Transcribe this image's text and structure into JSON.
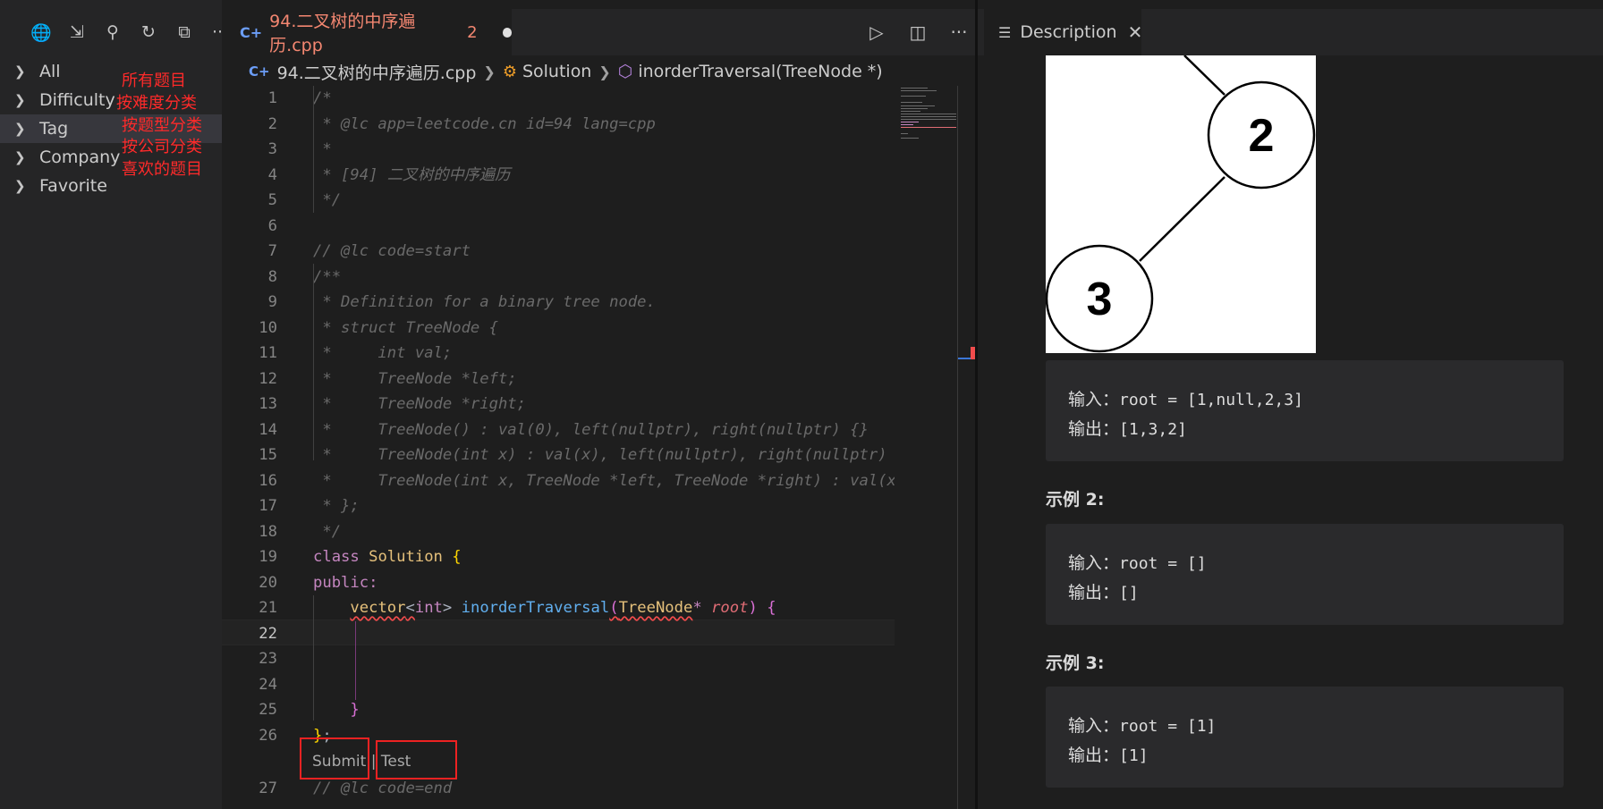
{
  "sidebar": {
    "toolbar": [
      {
        "icon": "globe-icon",
        "glyph": "🌐"
      },
      {
        "icon": "sign-in-icon",
        "glyph": "⇲"
      },
      {
        "icon": "search-icon",
        "glyph": "⚲"
      },
      {
        "icon": "refresh-icon",
        "glyph": "↻"
      },
      {
        "icon": "collapse-all-icon",
        "glyph": "⧉"
      },
      {
        "icon": "more-icon",
        "glyph": "···"
      }
    ],
    "items": [
      {
        "label": "All",
        "annotation": "所有题目"
      },
      {
        "label": "Difficulty",
        "annotation": "按难度分类"
      },
      {
        "label": "Tag",
        "annotation": "按题型分类"
      },
      {
        "label": "Company",
        "annotation": "按公司分类"
      },
      {
        "label": "Favorite",
        "annotation": "喜欢的题目"
      }
    ]
  },
  "editor": {
    "tab": {
      "title": "94.二叉树的中序遍历.cpp",
      "problem_count": "2",
      "icon": "cpp-file-icon"
    },
    "actions": [
      {
        "icon": "run-icon",
        "glyph": "▷"
      },
      {
        "icon": "split-editor-icon",
        "glyph": "◫"
      },
      {
        "icon": "more-icon",
        "glyph": "···"
      }
    ],
    "breadcrumb": {
      "file": "94.二叉树的中序遍历.cpp",
      "class": "Solution",
      "method": "inorderTraversal(TreeNode *)"
    },
    "current_line": "22",
    "codelens": {
      "submit": "Submit",
      "separator": "|",
      "test": "Test"
    }
  },
  "panel": {
    "tab_title": "Description",
    "tree_nodes": [
      "2",
      "3"
    ],
    "examples": [
      {
        "heading": "",
        "input_label": "输入：",
        "input": "root = [1,null,2,3]",
        "output_label": "输出：",
        "output": "[1,3,2]"
      },
      {
        "heading": "示例 2:",
        "input_label": "输入：",
        "input": "root = []",
        "output_label": "输出：",
        "output": "[]"
      },
      {
        "heading": "示例 3:",
        "input_label": "输入：",
        "input": "root = [1]",
        "output_label": "输出：",
        "output": "[1]"
      }
    ]
  },
  "colors": {
    "annotation": "#ff2a2a",
    "tab_title": "#f48771",
    "comment": "#6a6a6a",
    "keyword": "#c586c0",
    "type": "#e5c07b",
    "function": "#61afef"
  }
}
